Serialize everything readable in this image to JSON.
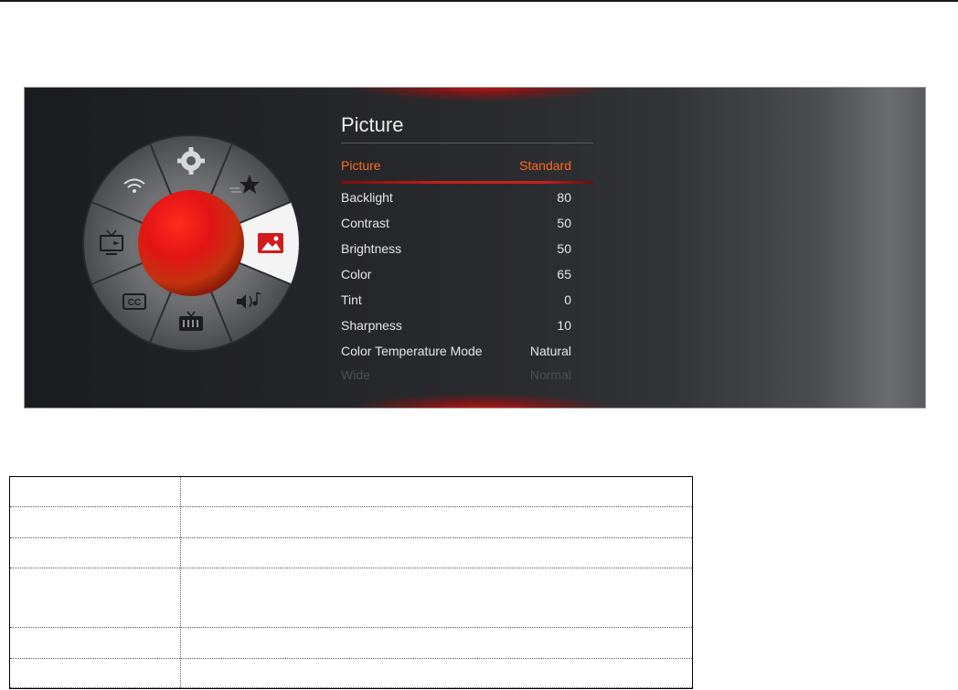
{
  "menu": {
    "title": "Picture",
    "items": [
      {
        "label": "Picture",
        "value": "Standard",
        "active": true
      },
      {
        "label": "Backlight",
        "value": "80"
      },
      {
        "label": "Contrast",
        "value": "50"
      },
      {
        "label": "Brightness",
        "value": "50"
      },
      {
        "label": "Color",
        "value": "65"
      },
      {
        "label": "Tint",
        "value": "0"
      },
      {
        "label": "Sharpness",
        "value": "10"
      },
      {
        "label": "Color Temperature Mode",
        "value": "Natural"
      },
      {
        "label": "Wide",
        "value": "Normal",
        "faded": true
      }
    ]
  },
  "wheel": {
    "segments": [
      {
        "icon": "gear-icon"
      },
      {
        "icon": "star-icon"
      },
      {
        "icon": "picture-icon",
        "selected": true
      },
      {
        "icon": "audio-icon"
      },
      {
        "icon": "tv-channel-icon"
      },
      {
        "icon": "closed-caption-icon"
      },
      {
        "icon": "input-source-icon"
      },
      {
        "icon": "wifi-icon"
      }
    ],
    "center_color": "#e01818"
  },
  "colors": {
    "accent": "#ff6a1f",
    "selection_bar": "#c81e1e"
  },
  "spec_table": {
    "rows": 6,
    "columns": 2
  }
}
